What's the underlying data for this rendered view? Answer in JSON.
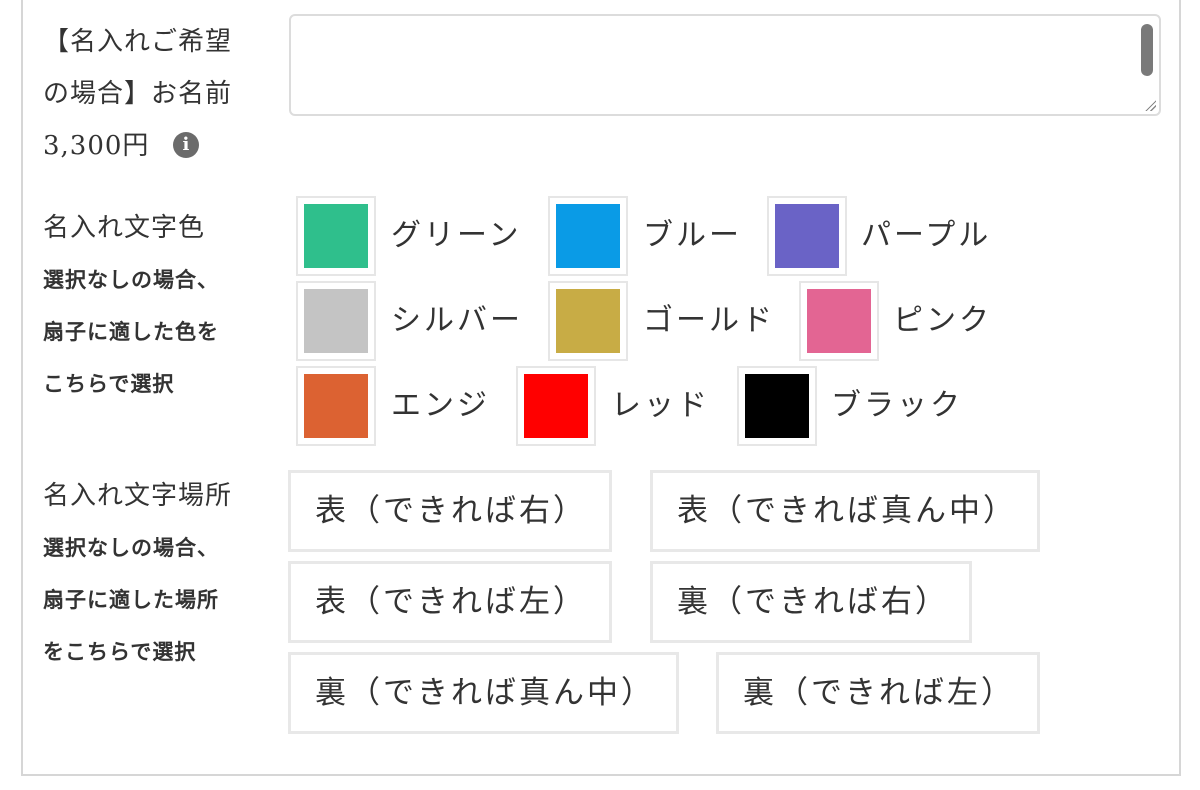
{
  "name_field": {
    "label_line1": "【名入れご希望",
    "label_line2": "の場合】お名前",
    "price": "3,300円",
    "info_glyph": "i",
    "value": ""
  },
  "color_section": {
    "title": "名入れ文字色",
    "note_lines": [
      "選択なしの場合、",
      "扇子に適した色を",
      "こちらで選択"
    ],
    "colors": [
      {
        "name": "グリーン",
        "hex": "#2fbf8c"
      },
      {
        "name": "ブルー",
        "hex": "#0a9be6"
      },
      {
        "name": "パープル",
        "hex": "#6a63c6"
      },
      {
        "name": "シルバー",
        "hex": "#c4c4c4"
      },
      {
        "name": "ゴールド",
        "hex": "#c8ac45"
      },
      {
        "name": "ピンク",
        "hex": "#e36593"
      },
      {
        "name": "エンジ",
        "hex": "#dc6232"
      },
      {
        "name": "レッド",
        "hex": "#ff0000"
      },
      {
        "name": "ブラック",
        "hex": "#000000"
      }
    ]
  },
  "position_section": {
    "title": "名入れ文字場所",
    "note_lines": [
      "選択なしの場合、",
      "扇子に適した場所",
      "をこちらで選択"
    ],
    "options": [
      "表（できれば右）",
      "表（できれば真ん中）",
      "表（できれば左）",
      "裏（できれば右）",
      "裏（できれば真ん中）",
      "裏（できれば左）"
    ]
  }
}
